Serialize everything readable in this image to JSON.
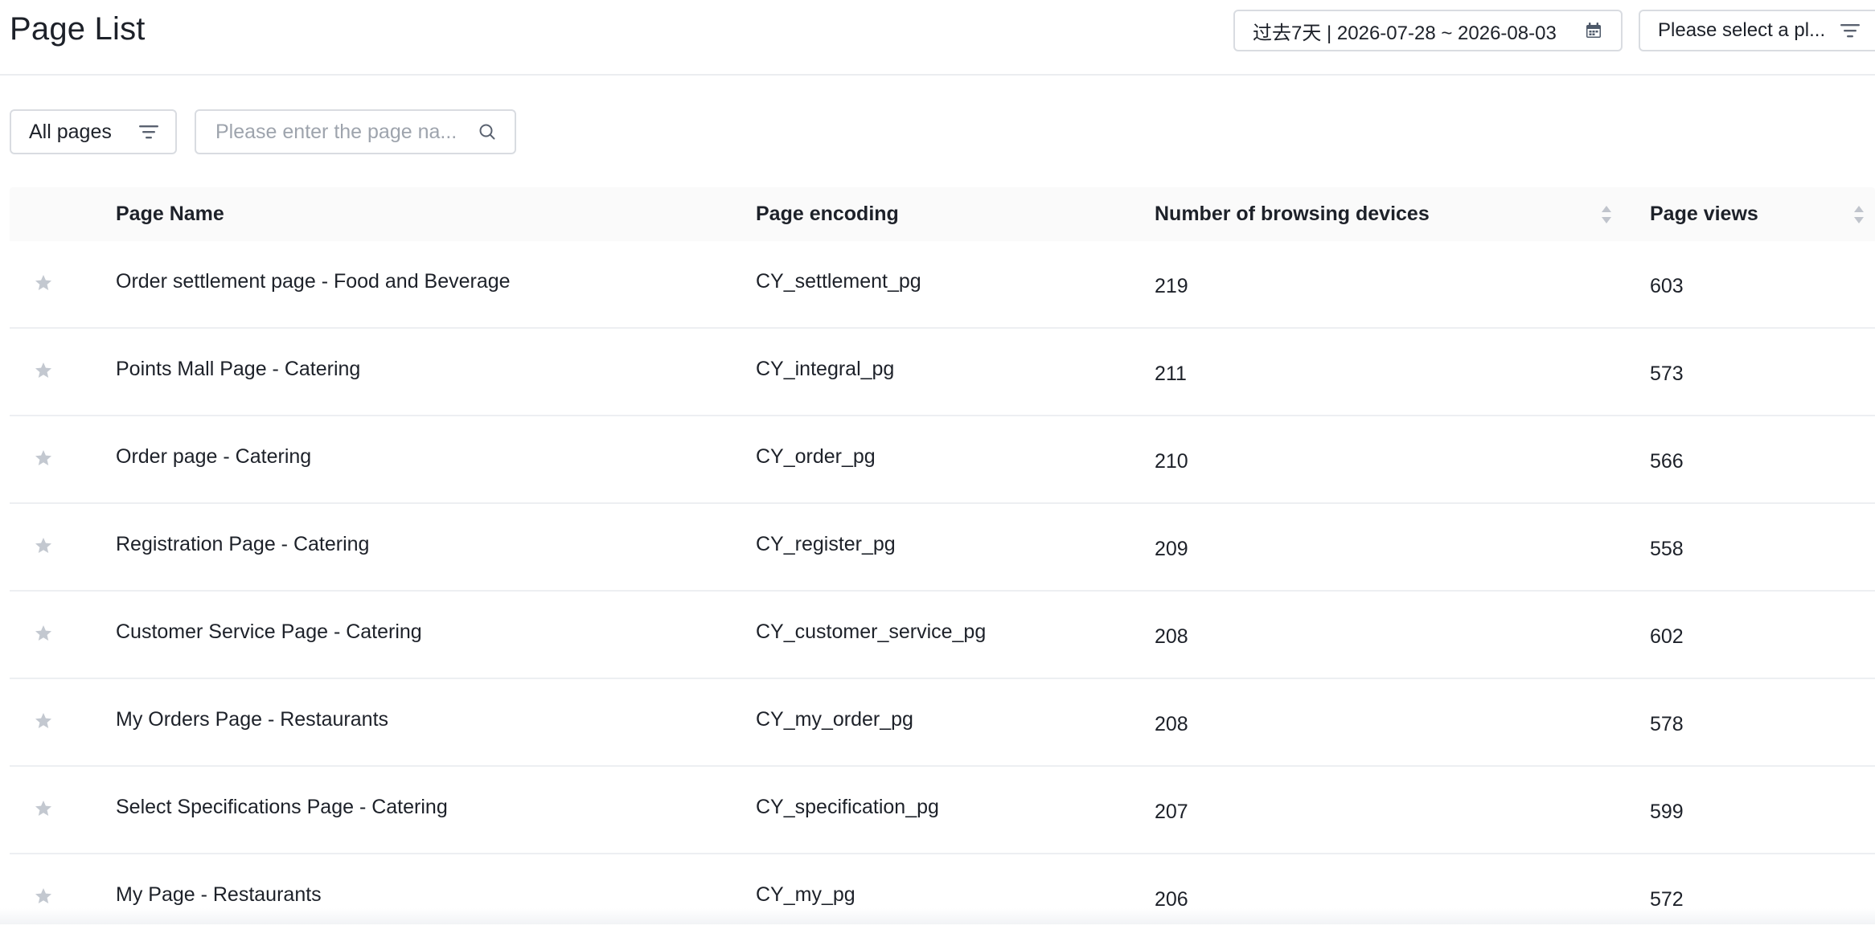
{
  "header": {
    "title": "Page List",
    "date_range_label": "过去7天 | 2026-07-28 ~ 2026-08-03",
    "platform_select_label": "Please select a pl..."
  },
  "filters": {
    "pages_filter_label": "All pages",
    "search_placeholder": "Please enter the page na...",
    "search_value": ""
  },
  "table": {
    "columns": {
      "page_name": "Page Name",
      "page_encoding": "Page encoding",
      "browsing_devices": "Number of browsing devices",
      "page_views": "Page views"
    },
    "rows": [
      {
        "name": "Order settlement page - Food and Beverage",
        "encoding": "CY_settlement_pg",
        "devices": "219",
        "views": "603"
      },
      {
        "name": "Points Mall Page - Catering",
        "encoding": "CY_integral_pg",
        "devices": "211",
        "views": "573"
      },
      {
        "name": "Order page - Catering",
        "encoding": "CY_order_pg",
        "devices": "210",
        "views": "566"
      },
      {
        "name": "Registration Page - Catering",
        "encoding": "CY_register_pg",
        "devices": "209",
        "views": "558"
      },
      {
        "name": "Customer Service Page - Catering",
        "encoding": "CY_customer_service_pg",
        "devices": "208",
        "views": "602"
      },
      {
        "name": "My Orders Page - Restaurants",
        "encoding": "CY_my_order_pg",
        "devices": "208",
        "views": "578"
      },
      {
        "name": "Select Specifications Page - Catering",
        "encoding": "CY_specification_pg",
        "devices": "207",
        "views": "599"
      },
      {
        "name": "My Page - Restaurants",
        "encoding": "CY_my_pg",
        "devices": "206",
        "views": "572"
      }
    ]
  },
  "colors": {
    "text": "#1d2129",
    "border": "#d9dce1",
    "header_bg": "#fafafa",
    "star": "#c3c8d0",
    "placeholder": "#9ea4ad",
    "sort_icon": "#c0c4cc"
  },
  "icons": {
    "date_range": "calendar-icon",
    "platform": "filter-icon",
    "pages_filter": "filter-icon",
    "search": "search-icon",
    "favorite": "star-icon",
    "sort": "sort-icon"
  }
}
